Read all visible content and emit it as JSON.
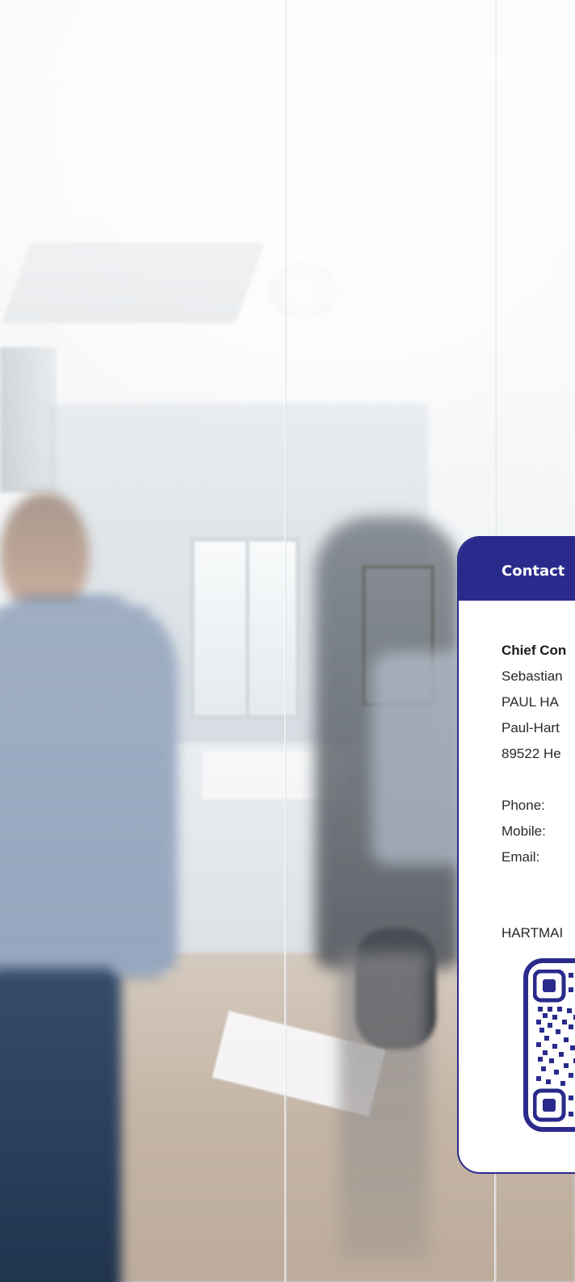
{
  "contact_card": {
    "header": "Contact",
    "title": "Chief Con",
    "lines": [
      "Sebastian",
      "PAUL HA",
      "Paul-Hart",
      "89522 He"
    ],
    "labels": {
      "phone": "Phone:",
      "mobile": "Mobile:",
      "email": "Email:"
    },
    "company": "HARTMAI",
    "qr_label": "qr-code"
  },
  "colors": {
    "brand": "#2a2a8c",
    "card_bg": "#ffffff",
    "text": "#1a1a1a"
  }
}
